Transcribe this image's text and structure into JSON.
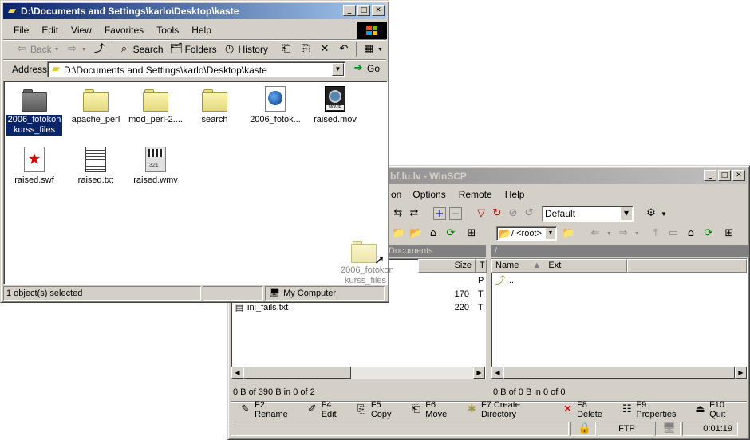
{
  "explorer": {
    "title": "D:\\Documents and Settings\\karlo\\Desktop\\kaste",
    "menu": [
      "File",
      "Edit",
      "View",
      "Favorites",
      "Tools",
      "Help"
    ],
    "toolbar": {
      "back": "Back",
      "search": "Search",
      "folders": "Folders",
      "history": "History"
    },
    "address_label": "Address",
    "address_value": "D:\\Documents and Settings\\karlo\\Desktop\\kaste",
    "go_label": "Go",
    "files": [
      {
        "name": "2006_fotokon kurss_files",
        "icon": "folder-dark-icon"
      },
      {
        "name": "apache_perl",
        "icon": "folder-icon"
      },
      {
        "name": "mod_perl-2....",
        "icon": "folder-icon"
      },
      {
        "name": "search",
        "icon": "folder-icon"
      },
      {
        "name": "2006_fotok...",
        "icon": "html-document-icon"
      },
      {
        "name": "raised.mov",
        "icon": "movie-file-icon"
      },
      {
        "name": "raised.swf",
        "icon": "flash-file-icon"
      },
      {
        "name": "raised.txt",
        "icon": "text-file-icon"
      },
      {
        "name": "raised.wmv",
        "icon": "video-file-icon"
      }
    ],
    "drag_ghost_label": "2006_fotokon kurss_files",
    "status_selected": "1 object(s) selected",
    "status_location": "My Computer"
  },
  "winscp": {
    "title": "e.bf.lu.lv - WinSCP",
    "menu": [
      "on",
      "Options",
      "Remote",
      "Help"
    ],
    "session_select": "Default",
    "remote_path": "/ <root>",
    "local_path_label": "Documents",
    "remote_path_label": "/",
    "local_columns": {
      "size": "Size",
      "type": "T"
    },
    "remote_columns": {
      "name": "Name",
      "ext": "Ext"
    },
    "local_rows": [
      {
        "name": "",
        "size": "",
        "type": "P"
      },
      {
        "name": "",
        "size": "170",
        "type": "T"
      },
      {
        "name": "ini_fails.txt",
        "size": "220",
        "type": "T"
      }
    ],
    "remote_rows": [
      {
        "name": ".."
      }
    ],
    "local_status": "0 B of 390 B in 0 of 2",
    "remote_status": "0 B of 0 B in 0 of 0",
    "fn_keys": [
      "F2 Rename",
      "F4 Edit",
      "F5 Copy",
      "F6 Move",
      "F7 Create Directory",
      "F8 Delete",
      "F9 Properties",
      "F10 Quit"
    ],
    "protocol": "FTP",
    "elapsed": "0:01:19"
  }
}
